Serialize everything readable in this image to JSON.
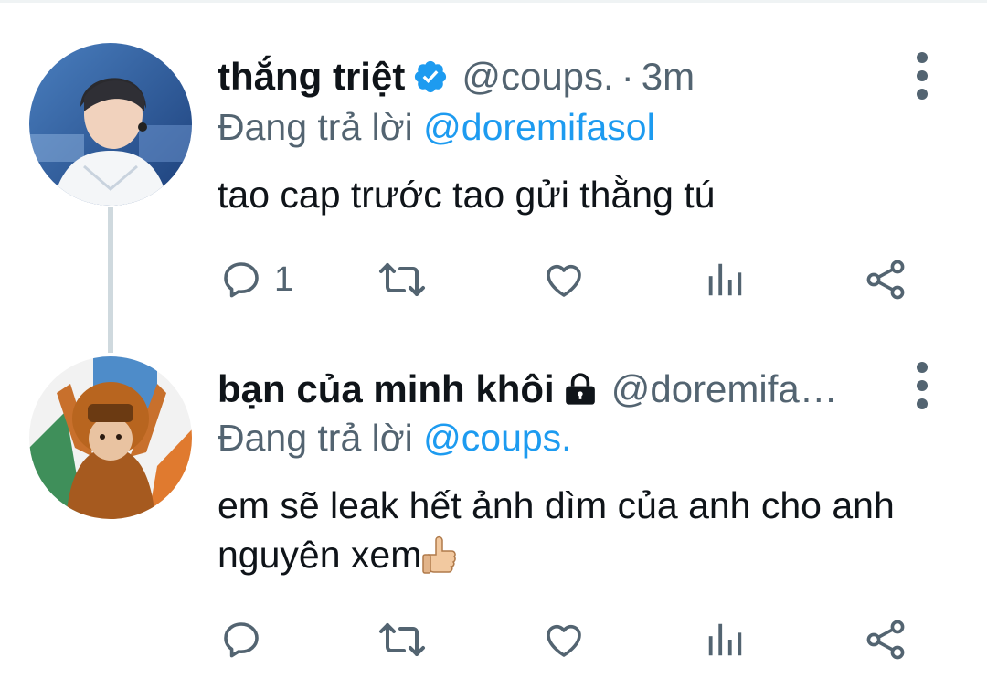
{
  "tweets": [
    {
      "display_name": "thắng triệt",
      "verified_icon": "verified-badge-icon",
      "handle": "@coups.",
      "separator": "·",
      "time": "3m",
      "reply_prefix": "Đang trả lời",
      "reply_mention": "@doremifasol",
      "text": "tao cap trước tao gửi thằng tú",
      "reply_count": "1"
    },
    {
      "display_name": "bạn của minh khôi",
      "protected_icon": "lock-icon",
      "handle": "@doremifa…",
      "reply_prefix": "Đang trả lời",
      "reply_mention": "@coups.",
      "text": "em sẽ leak hết ảnh dìm của anh cho anh nguyên xem",
      "emoji": "thumbs-up-emoji"
    }
  ],
  "action_icons": [
    "reply-icon",
    "retweet-icon",
    "like-icon",
    "analytics-icon",
    "share-icon"
  ],
  "colors": {
    "mention": "#1d9bf0",
    "secondary_text": "#536471",
    "primary_text": "#0f1419",
    "verified": "#1d9bf0",
    "thread_line": "#cfd9de"
  }
}
